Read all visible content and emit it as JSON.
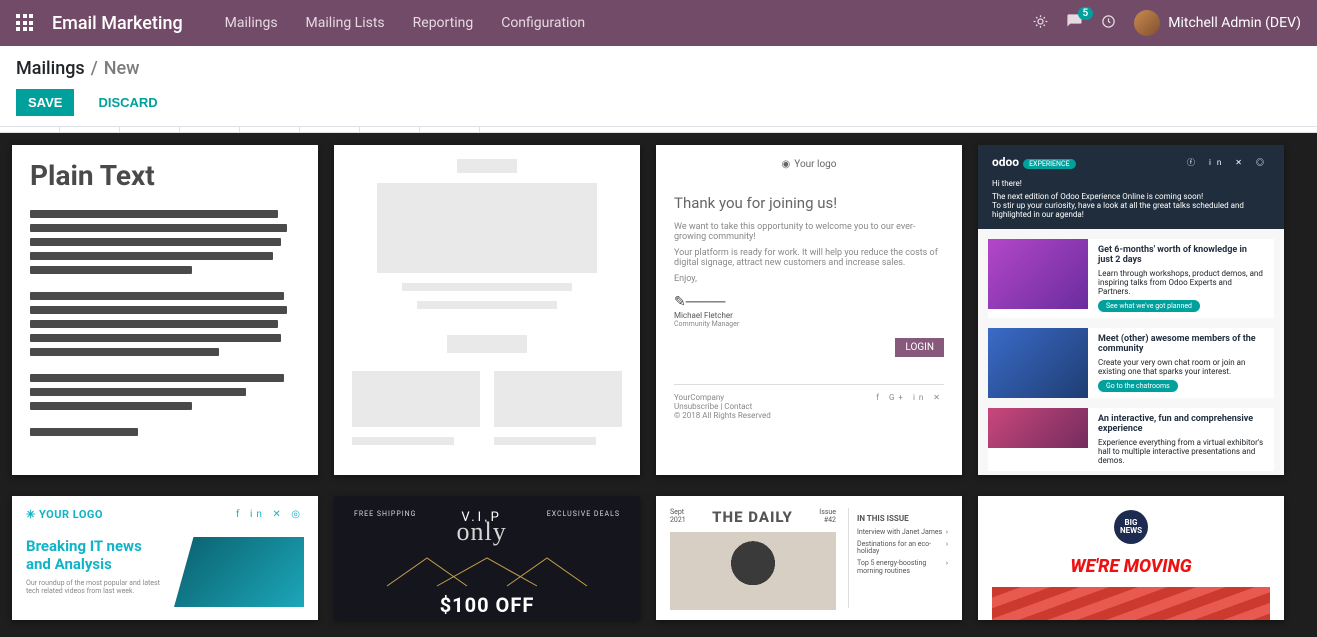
{
  "navbar": {
    "app_title": "Email Marketing",
    "menu": [
      "Mailings",
      "Mailing Lists",
      "Reporting",
      "Configuration"
    ],
    "messages_badge": "5",
    "user_name": "Mitchell Admin (DEV)"
  },
  "breadcrumb": {
    "root": "Mailings",
    "sep": "/",
    "current": "New"
  },
  "buttons": {
    "save": "Save",
    "discard": "Discard"
  },
  "templates": {
    "plain": {
      "title": "Plain Text"
    },
    "welcome": {
      "logo": "Your logo",
      "heading": "Thank you for joining us!",
      "p1": "We want to take this opportunity to welcome you to our ever-growing community!",
      "p2": "Your platform is ready for work. It will help you reduce the costs of digital signage, attract new customers and increase sales.",
      "enjoy": "Enjoy,",
      "sig_name": "Michael Fletcher",
      "sig_role": "Community Manager",
      "cta": "LOGIN",
      "footer_company": "YourCompany",
      "footer_unsub": "Unsubscribe",
      "footer_contact": "Contact",
      "footer_copy": "© 2018 All Rights Reserved"
    },
    "event": {
      "brand": "odoo",
      "brand_tag": "EXPERIENCE",
      "hi": "Hi there!",
      "intro1": "The next edition of Odoo Experience Online is coming soon!",
      "intro2": "To stir up your curiosity, have a look at all the great talks scheduled and highlighted in our agenda!",
      "rows": [
        {
          "h": "Get 6-months' worth of knowledge in just 2 days",
          "p": "Learn through workshops, product demos, and inspiring talks from Odoo Experts and Partners.",
          "cta": "See what we've got planned"
        },
        {
          "h": "Meet (other) awesome members of the community",
          "p": "Create your very own chat room or join an existing one that sparks your interest.",
          "cta": "Go to the chatrooms"
        },
        {
          "h": "An interactive, fun and comprehensive experience",
          "p": "Experience everything from a virtual exhibitor's hall to multiple interactive presentations and demos.",
          "cta": ""
        }
      ]
    },
    "it": {
      "logo": "✳ YOUR LOGO",
      "headline": "Breaking IT news and Analysis",
      "sub": "Our roundup of the most popular and latest tech related videos from last week."
    },
    "vip": {
      "left": "FREE SHIPPING",
      "center_top": "V.I.P",
      "center_script": "only",
      "right": "EXCLUSIVE DEALS",
      "price": "$100 OFF"
    },
    "daily": {
      "date_m": "Sept",
      "date_y": "2021",
      "title": "THE DAILY",
      "issue_l": "Issue",
      "issue_n": "#42",
      "side_h": "IN THIS ISSUE",
      "items": [
        "Interview with Janet James",
        "Destinations for an eco-holiday",
        "Top 5 energy-boosting morning routines"
      ]
    },
    "moving": {
      "badge1": "BIG",
      "badge2": "NEWS",
      "title": "WE'RE MOVING"
    }
  }
}
